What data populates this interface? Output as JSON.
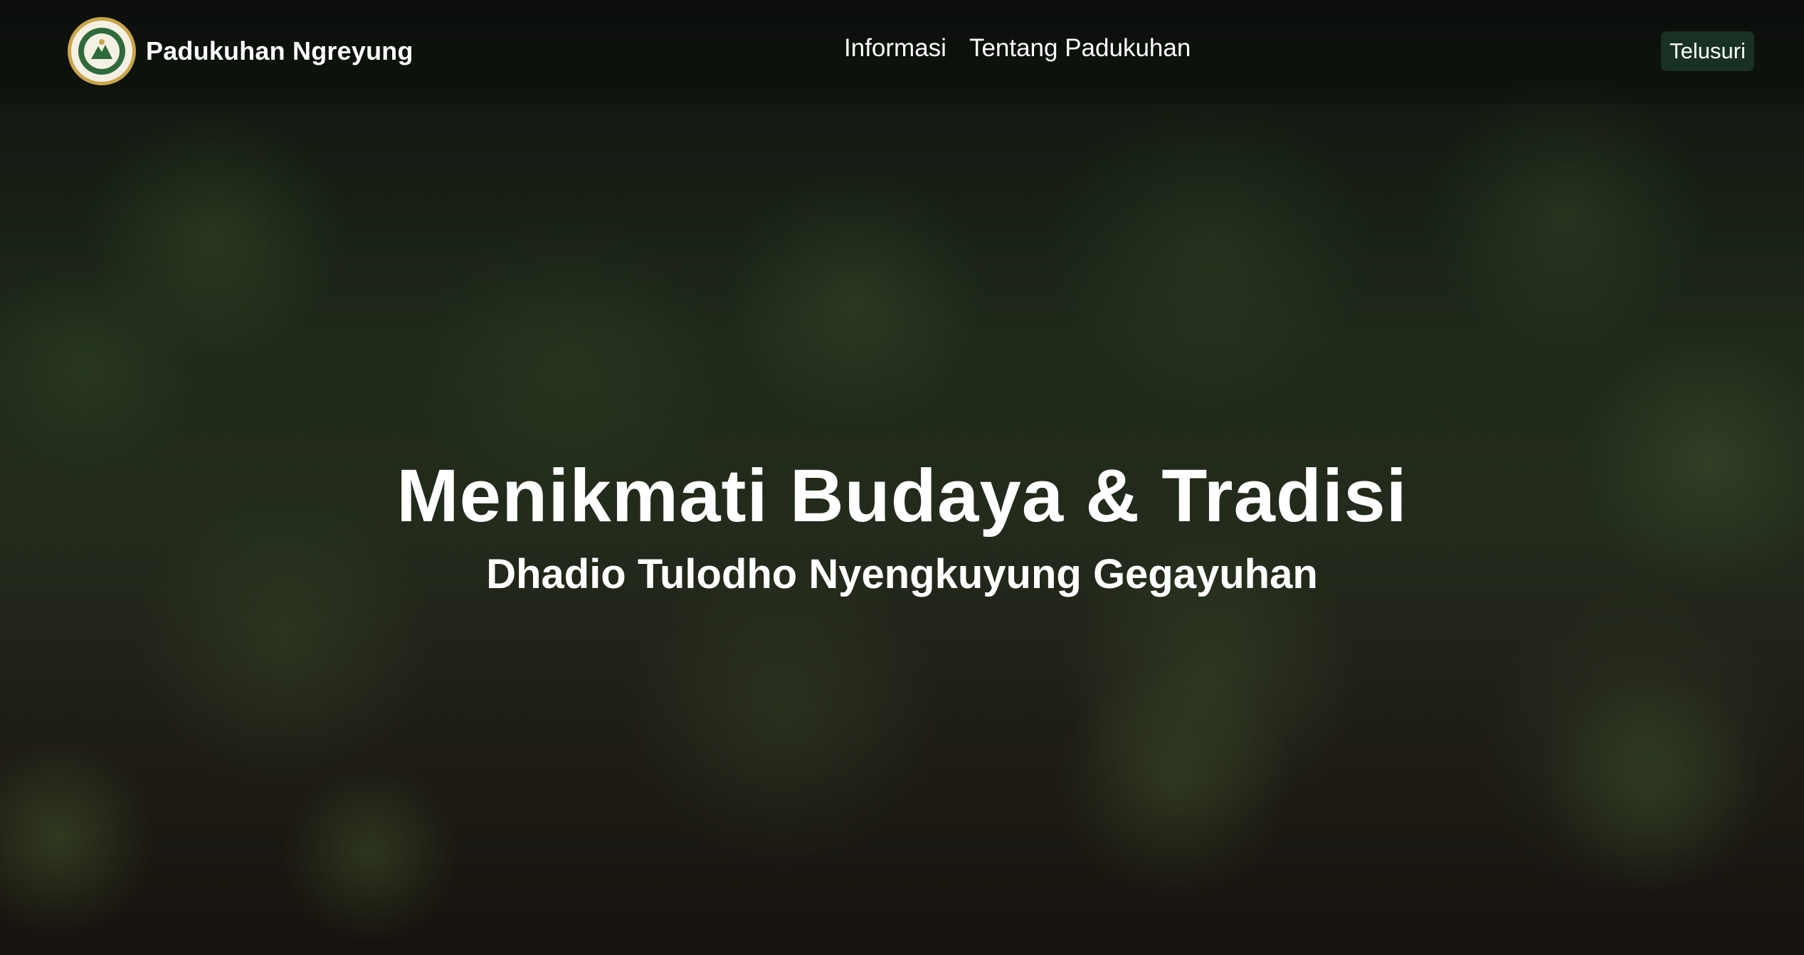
{
  "brand": {
    "name": "Padukuhan Ngreyung",
    "logo_icon": "village-emblem-icon"
  },
  "nav": {
    "items": [
      {
        "label": "Informasi"
      },
      {
        "label": "Tentang Padukuhan"
      }
    ],
    "cta_label": "Telusuri"
  },
  "hero": {
    "title": "Menikmati Budaya & Tradisi",
    "subtitle": "Dhadio Tulodho Nyengkuyung Gegayuhan",
    "background": "forest-village-photo"
  },
  "colors": {
    "cta_background": "#1e3c2d",
    "logo_ring": "#c9a64a",
    "text": "#ffffff"
  }
}
